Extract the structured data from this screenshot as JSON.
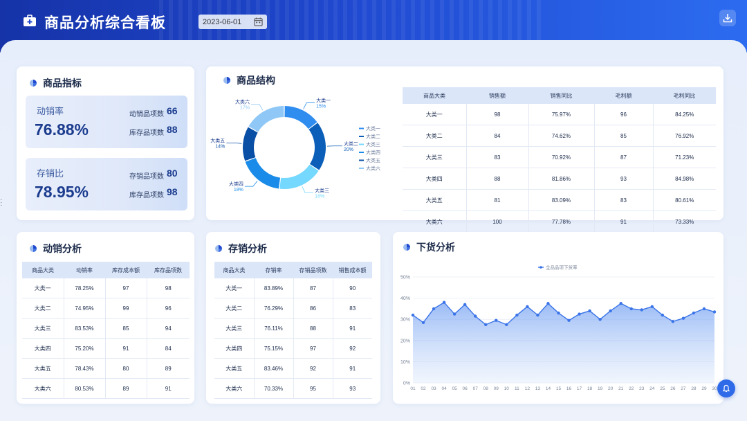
{
  "header": {
    "title": "商品分析综合看板",
    "date": "2023-06-01",
    "logo_icon": "briefcase-icon",
    "calendar_icon": "calendar-icon",
    "download_icon": "download-icon"
  },
  "indicators": {
    "title": "商品指标",
    "cards": [
      {
        "label": "动销率",
        "value": "76.88%",
        "sub1_label": "动销品项数",
        "sub1_value": "66",
        "sub2_label": "库存品项数",
        "sub2_value": "88"
      },
      {
        "label": "存销比",
        "value": "78.95%",
        "sub1_label": "存销品项数",
        "sub1_value": "80",
        "sub2_label": "库存品项数",
        "sub2_value": "98"
      }
    ]
  },
  "structure": {
    "title": "商品结构",
    "donut_labels": [
      {
        "name": "大类一",
        "pct": "15%"
      },
      {
        "name": "大类二",
        "pct": "20%"
      },
      {
        "name": "大类三",
        "pct": "18%"
      },
      {
        "name": "大类四",
        "pct": "18%"
      },
      {
        "name": "大类五",
        "pct": "14%"
      },
      {
        "name": "大类六",
        "pct": "17%"
      }
    ],
    "legend": [
      "大类一",
      "大类二",
      "大类三",
      "大类四",
      "大类五",
      "大类六"
    ],
    "colors": [
      "#2f8df0",
      "#0b5fb8",
      "#74d8ff",
      "#1a8be8",
      "#0a4fa6",
      "#8fc8f6"
    ],
    "table": {
      "headers": [
        "商品大类",
        "销售额",
        "销售同比",
        "毛利额",
        "毛利同比"
      ],
      "rows": [
        [
          "大类一",
          "98",
          "75.97%",
          "96",
          "84.25%"
        ],
        [
          "大类二",
          "84",
          "74.62%",
          "85",
          "76.92%"
        ],
        [
          "大类三",
          "83",
          "70.92%",
          "87",
          "71.23%"
        ],
        [
          "大类四",
          "88",
          "81.86%",
          "93",
          "84.98%"
        ],
        [
          "大类五",
          "81",
          "83.09%",
          "83",
          "80.61%"
        ],
        [
          "大类六",
          "100",
          "77.78%",
          "91",
          "73.33%"
        ]
      ]
    }
  },
  "movement": {
    "title": "动销分析",
    "headers": [
      "商品大类",
      "动销率",
      "库存成本额",
      "库存品项数"
    ],
    "rows": [
      [
        "大类一",
        "78.25%",
        "97",
        "98"
      ],
      [
        "大类二",
        "74.95%",
        "99",
        "96"
      ],
      [
        "大类三",
        "83.53%",
        "85",
        "94"
      ],
      [
        "大类四",
        "75.20%",
        "91",
        "84"
      ],
      [
        "大类五",
        "78.43%",
        "80",
        "89"
      ],
      [
        "大类六",
        "80.53%",
        "89",
        "91"
      ]
    ]
  },
  "stock": {
    "title": "存销分析",
    "headers": [
      "商品大类",
      "存销率",
      "存销品项数",
      "销售成本额"
    ],
    "rows": [
      [
        "大类一",
        "83.89%",
        "87",
        "90"
      ],
      [
        "大类二",
        "76.29%",
        "86",
        "83"
      ],
      [
        "大类三",
        "76.11%",
        "88",
        "91"
      ],
      [
        "大类四",
        "75.15%",
        "97",
        "92"
      ],
      [
        "大类五",
        "83.46%",
        "92",
        "91"
      ],
      [
        "大类六",
        "70.33%",
        "95",
        "93"
      ]
    ]
  },
  "delist": {
    "title": "下货分析",
    "float_icon": "bell-icon"
  },
  "chart_data": {
    "type": "area",
    "title": "",
    "series": [
      {
        "name": "全品品项下货率",
        "values": [
          32,
          28.5,
          35,
          38,
          32.5,
          37,
          31.5,
          27.5,
          29.5,
          27.5,
          32,
          36,
          32,
          37.5,
          33,
          29.5,
          32.5,
          34,
          30,
          34,
          37.5,
          35,
          34.5,
          36,
          32,
          29,
          30.5,
          33,
          35,
          33.5
        ]
      }
    ],
    "categories": [
      "01",
      "02",
      "03",
      "04",
      "05",
      "06",
      "07",
      "08",
      "09",
      "10",
      "11",
      "12",
      "13",
      "14",
      "15",
      "16",
      "17",
      "18",
      "19",
      "20",
      "21",
      "22",
      "23",
      "24",
      "25",
      "26",
      "27",
      "28",
      "29",
      "30"
    ],
    "yticks": [
      "0%",
      "10%",
      "20%",
      "30%",
      "40%",
      "50%"
    ],
    "ylim": [
      0,
      50
    ],
    "legend_position": "top-center",
    "color": "#3a74e8"
  }
}
